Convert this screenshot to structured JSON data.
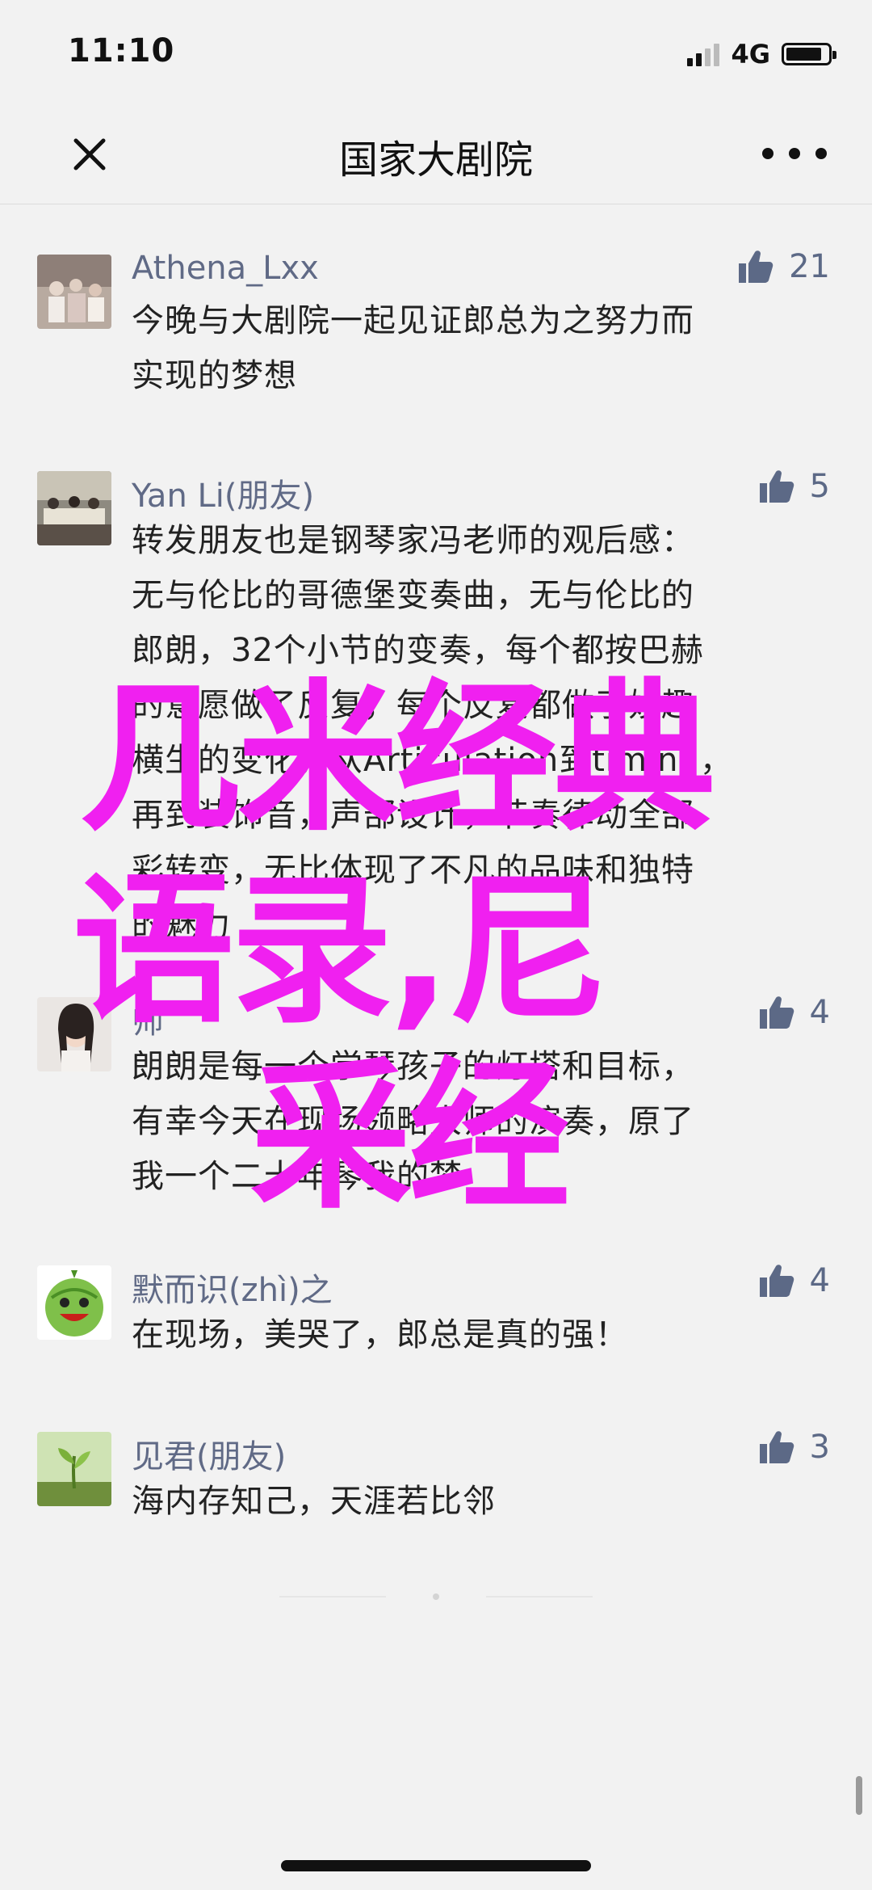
{
  "status_bar": {
    "time": "11:10",
    "network": "4G",
    "battery_level": 0.85
  },
  "nav": {
    "title": "国家大剧院",
    "close_icon": "close-icon",
    "more_icon": "more-dots-icon"
  },
  "comments": [
    {
      "name": "Athena_Lxx",
      "likes": "21",
      "text": [
        "今晚与大剧院一起见证郎总为之努力而",
        "实现的梦想"
      ]
    },
    {
      "name": "Yan Li(朋友)",
      "likes": "5",
      "text": [
        "转发朋友也是钢琴家冯老师的观后感：",
        "无与伦比的哥德堡变奏曲，无与伦比的",
        "郎朗，32个小节的变奏，每个都按巴赫",
        "的意愿做了反复，每个反复都做了妙趣",
        "横生的变化，从Articulation到timing，",
        "再到装饰音，声部设计，节奏律动全部",
        "彩转变，无比体现了不凡的品味和独特",
        "的魅力"
      ]
    },
    {
      "name": "师",
      "likes": "4",
      "text": [
        "朗朗是每一个学琴孩子的灯塔和目标，",
        "有幸今天在现场领略大师的演奏，原了",
        "我一个二十年琴我的梦"
      ]
    },
    {
      "name": "默而识(zhì)之",
      "likes": "4",
      "text": [
        "在现场，美哭了，郎总是真的强！"
      ]
    },
    {
      "name": "见君(朋友)",
      "likes": "3",
      "text": [
        "海内存知己，天涯若比邻"
      ]
    }
  ],
  "overlay": {
    "line1": "几米经典",
    "line2": "语录,尼",
    "line3": "采经"
  },
  "colors": {
    "overlay": "#f020f0",
    "name": "#606a86",
    "like": "#5c6986"
  }
}
